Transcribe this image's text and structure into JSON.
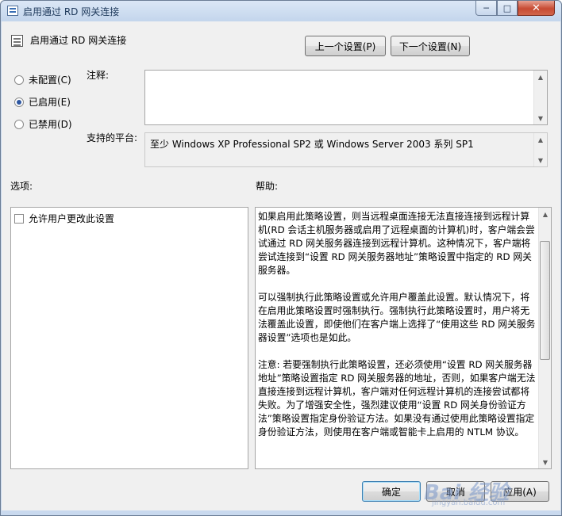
{
  "window": {
    "title": "启用通过 RD 网关连接",
    "controls": {
      "minimize": "─",
      "maximize": "□",
      "close": "✕"
    }
  },
  "policy": {
    "title": "启用通过 RD 网关连接",
    "prev_button": "上一个设置(P)",
    "next_button": "下一个设置(N)"
  },
  "state": {
    "options": [
      {
        "label": "未配置(C)",
        "checked": false
      },
      {
        "label": "已启用(E)",
        "checked": true
      },
      {
        "label": "已禁用(D)",
        "checked": false
      }
    ]
  },
  "comment": {
    "label": "注释:",
    "value": ""
  },
  "platform": {
    "label": "支持的平台:",
    "value": "至少 Windows XP Professional SP2 或 Windows Server 2003 系列 SP1"
  },
  "options_section": {
    "label": "选项:",
    "checkbox_label": "允许用户更改此设置",
    "checkbox_checked": false
  },
  "help_section": {
    "label": "帮助:",
    "paragraphs": [
      "如果启用此策略设置，则当远程桌面连接无法直接连接到远程计算机(RD 会话主机服务器或启用了远程桌面的计算机)时，客户端会尝试通过 RD 网关服务器连接到远程计算机。这种情况下，客户端将尝试连接到“设置 RD 网关服务器地址”策略设置中指定的 RD 网关服务器。",
      "可以强制执行此策略设置或允许用户覆盖此设置。默认情况下，将在启用此策略设置时强制执行。强制执行此策略设置时，用户将无法覆盖此设置，即使他们在客户端上选择了“使用这些 RD 网关服务器设置”选项也是如此。",
      "注意: 若要强制执行此策略设置，还必须使用“设置 RD 网关服务器地址”策略设置指定 RD 网关服务器的地址，否则，如果客户端无法直接连接到远程计算机，客户端对任何远程计算机的连接尝试都将失败。为了增强安全性，强烈建议使用“设置 RD 网关身份验证方法”策略设置指定身份验证方法。如果没有通过使用此策略设置指定身份验证方法，则使用在客户端或智能卡上启用的 NTLM 协议。"
    ]
  },
  "footer": {
    "ok_button": "确定",
    "cancel_button": "取消",
    "apply_button": "应用(A)"
  },
  "watermark": {
    "line1": "Bai 经验",
    "line2": "jingyan.baidu.com"
  },
  "colors": {
    "titlebar": "#c9d9ee",
    "client_bg": "#f0f0f0",
    "close_button": "#c74b33",
    "radio_dot": "#2d56a0"
  }
}
